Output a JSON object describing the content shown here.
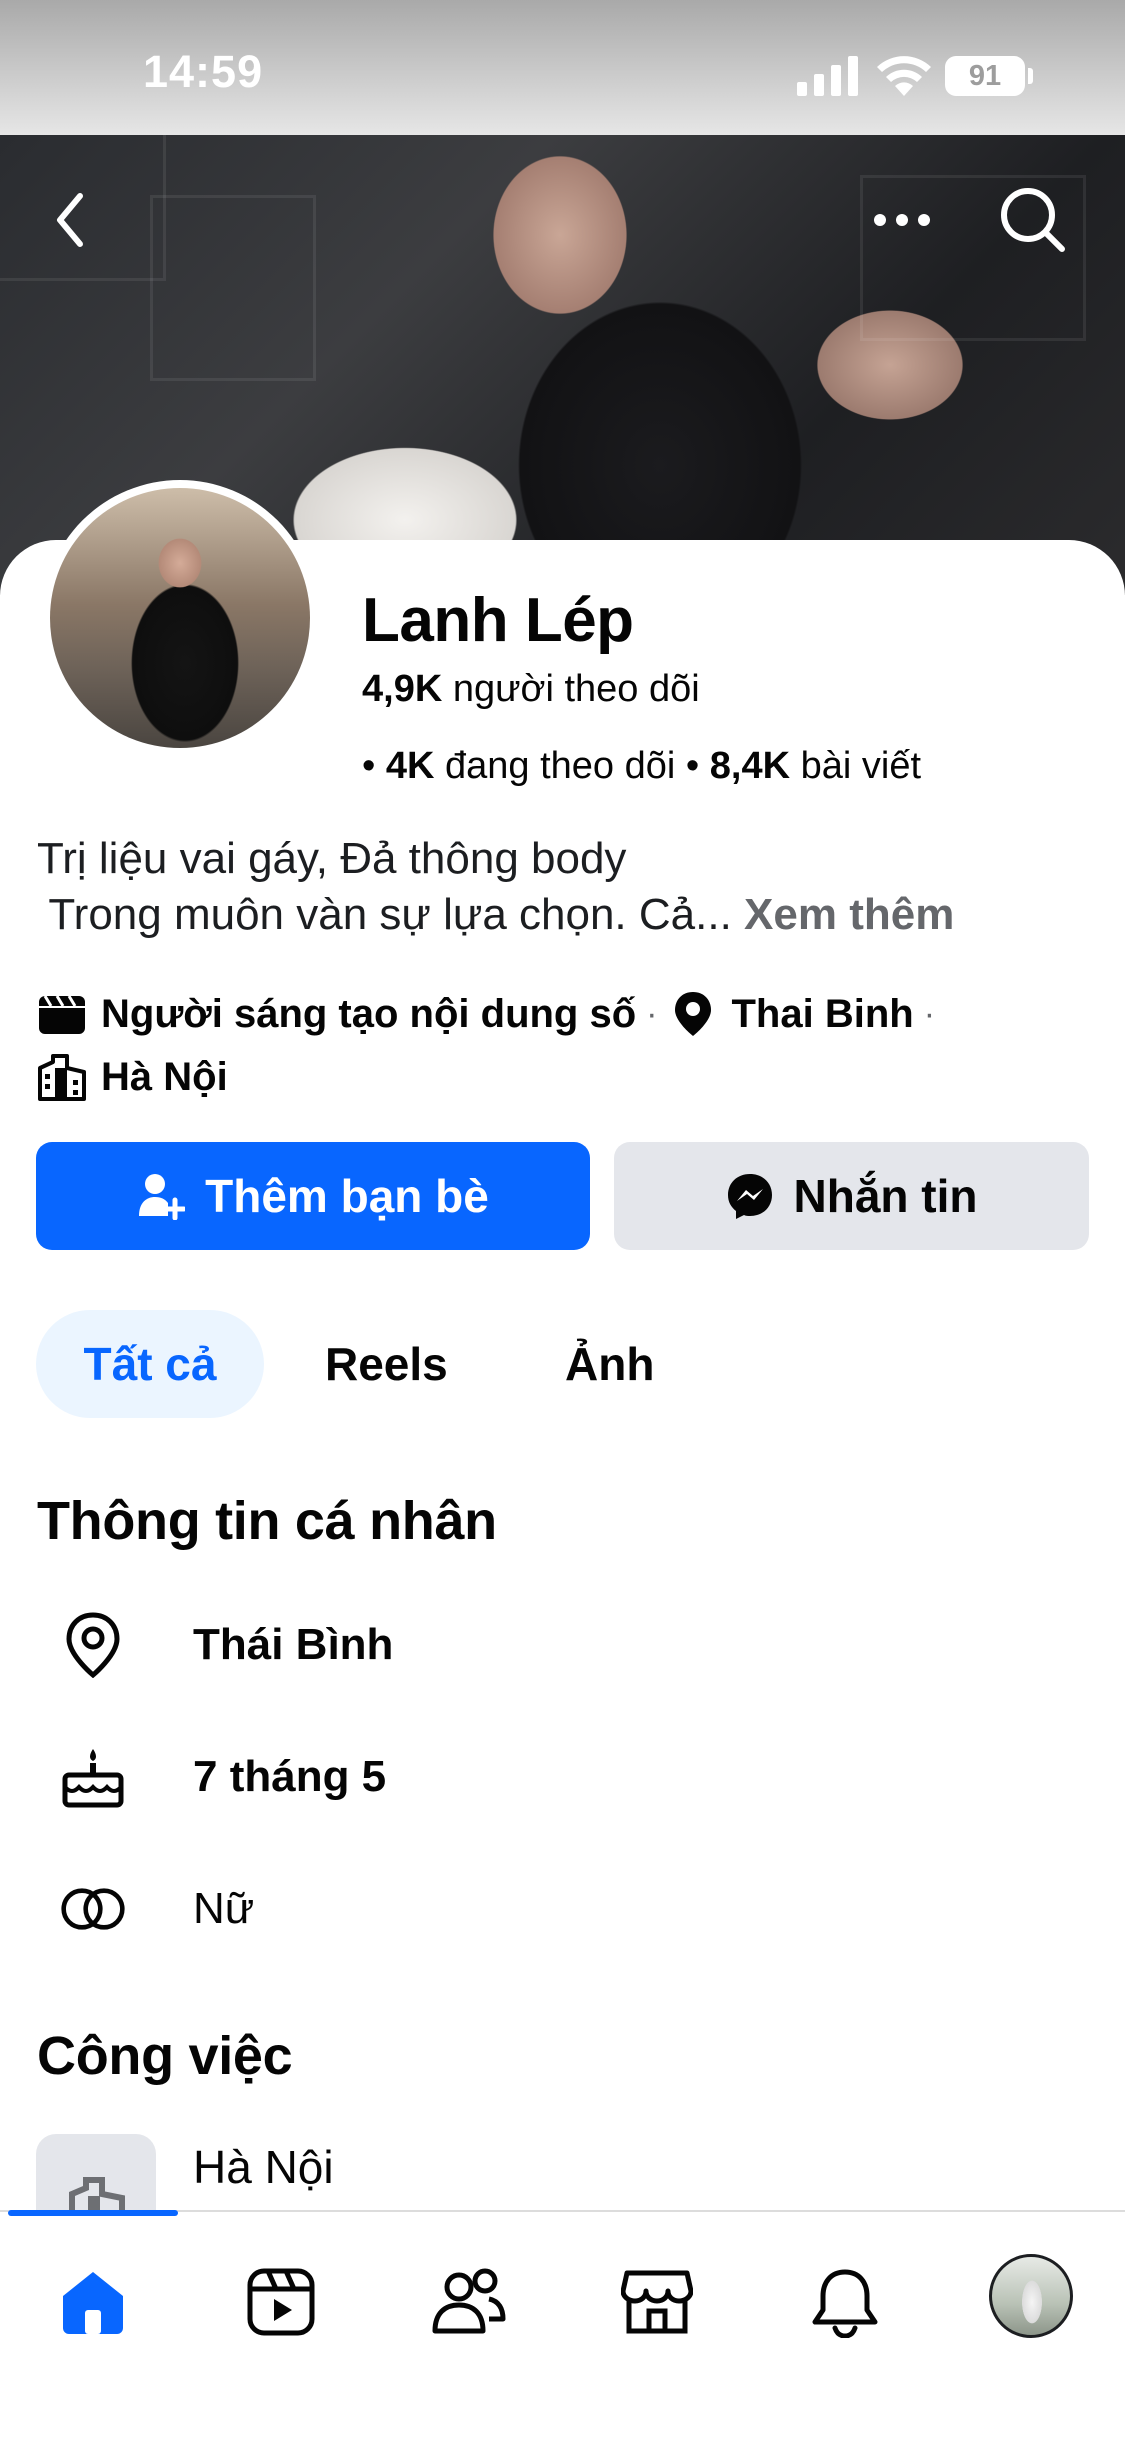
{
  "status_bar": {
    "time": "14:59",
    "battery": "91"
  },
  "profile": {
    "name": "Lanh Lép",
    "followers_count": "4,9K",
    "followers_label": " người theo dõi",
    "following_count": "4K",
    "following_label": " đang theo dõi",
    "posts_count": "8,4K",
    "posts_label": " bài viết",
    "bio_line1": "Trị liệu vai gáy, Đả thông body",
    "bio_line2": " Trong muôn vàn sự lựa chọn. Cả... ",
    "see_more": "Xem thêm",
    "category": "Người sáng tạo nội dung số",
    "hometown": "Thai Binh",
    "city": "Hà Nội"
  },
  "actions": {
    "add_friend": "Thêm bạn bè",
    "message": "Nhắn tin"
  },
  "tabs": [
    {
      "label": "Tất cả",
      "active": true
    },
    {
      "label": "Reels"
    },
    {
      "label": "Ảnh"
    }
  ],
  "personal_info": {
    "title": "Thông tin cá nhân",
    "items": [
      {
        "icon": "location-pin-icon",
        "text": "Thái Bình"
      },
      {
        "icon": "birthday-cake-icon",
        "text": "7 tháng 5"
      },
      {
        "icon": "gender-icon",
        "text": "Nữ"
      }
    ]
  },
  "work": {
    "title": "Công việc",
    "items": [
      {
        "icon": "building-icon",
        "text": "Hà Nội"
      }
    ]
  },
  "bottom_nav": {
    "items": [
      {
        "icon": "home-icon",
        "active": true
      },
      {
        "icon": "reels-icon"
      },
      {
        "icon": "friends-icon"
      },
      {
        "icon": "marketplace-icon"
      },
      {
        "icon": "notifications-icon"
      },
      {
        "icon": "profile-avatar-icon"
      }
    ]
  },
  "colors": {
    "accent": "#0866ff",
    "accent_bg": "#ebf5ff",
    "secondary_button": "#e4e6eb",
    "muted_text": "#65676b"
  }
}
